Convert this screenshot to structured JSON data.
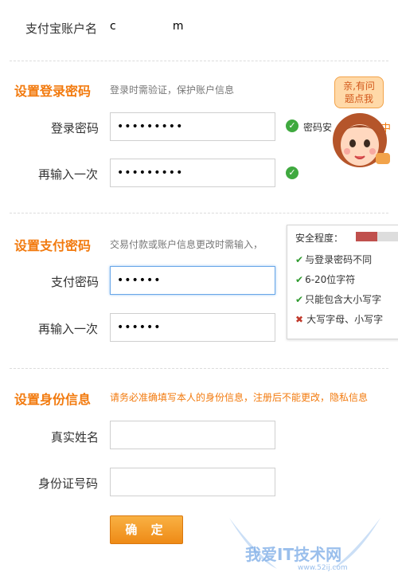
{
  "account": {
    "label": "支付宝账户名",
    "value": "c                m"
  },
  "login_section": {
    "title": "设置登录密码",
    "desc": "登录时需验证，保护账户信息",
    "password_label": "登录密码",
    "password_value": "•••••••••",
    "confirm_label": "再输入一次",
    "confirm_value": "•••••••••",
    "strength_text": "密码安",
    "strength_text_tail": "中"
  },
  "pay_section": {
    "title": "设置支付密码",
    "desc": "交易付款或账户信息更改时需输入，",
    "password_label": "支付密码",
    "password_value": "••••••",
    "confirm_label": "再输入一次",
    "confirm_value": "••••••"
  },
  "tip": {
    "title": "安全程度：",
    "strength_fraction": 0.45,
    "rules": [
      {
        "ok": true,
        "text": "与登录密码不同"
      },
      {
        "ok": true,
        "text": "6-20位字符"
      },
      {
        "ok": true,
        "text": "只能包含大小写字"
      },
      {
        "ok": false,
        "text": "大写字母、小写字"
      }
    ]
  },
  "id_section": {
    "title": "设置身份信息",
    "desc": "请务必准确填写本人的身份信息，注册后不能更改，隐私信息",
    "name_label": "真实姓名",
    "name_value": "",
    "id_label": "身份证号码",
    "id_value": ""
  },
  "confirm_button": "确 定",
  "mascot": {
    "bubble_line1": "亲,有问",
    "bubble_line2": "题点我"
  },
  "watermark": {
    "text": "我爱IT技术网",
    "url": "www.52ij.com"
  },
  "colors": {
    "accent": "#f27a0e",
    "ok": "#3fa93f",
    "fail": "#c0392b",
    "button": "#ee8a16"
  }
}
